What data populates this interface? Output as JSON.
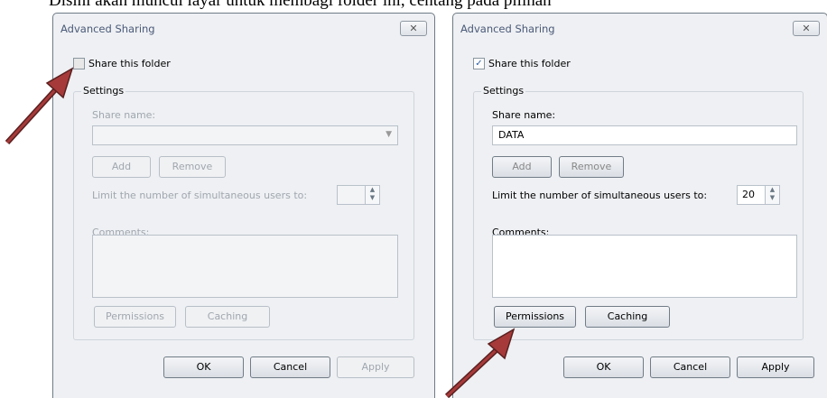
{
  "caption": "Disini akan muncul layar untuk membagi folder ini, centang pada pilihan",
  "dialog_left": {
    "title": "Advanced Sharing",
    "close_icon": "✕",
    "share_label": "Share this folder",
    "share_checked": false,
    "settings_label": "Settings",
    "share_name_label": "Share name:",
    "share_name_value": "",
    "add_label": "Add",
    "remove_label": "Remove",
    "limit_label": "Limit the number of simultaneous users to:",
    "limit_value": "",
    "comments_label": "Comments:",
    "permissions_label": "Permissions",
    "caching_label": "Caching",
    "ok_label": "OK",
    "cancel_label": "Cancel",
    "apply_label": "Apply"
  },
  "dialog_right": {
    "title": "Advanced Sharing",
    "close_icon": "✕",
    "share_label": "Share this folder",
    "share_checked": true,
    "check_mark": "✓",
    "settings_label": "Settings",
    "share_name_label": "Share name:",
    "share_name_value": "DATA",
    "add_label": "Add",
    "remove_label": "Remove",
    "limit_label": "Limit the number of simultaneous users to:",
    "limit_value": "20",
    "comments_label": "Comments:",
    "permissions_label": "Permissions",
    "caching_label": "Caching",
    "ok_label": "OK",
    "cancel_label": "Cancel",
    "apply_label": "Apply"
  },
  "icons": {
    "spin_up": "▲",
    "spin_down": "▼",
    "combo_down": "▼"
  },
  "colors": {
    "arrow": "#a63a3a",
    "accent": "#2b5fa8"
  }
}
